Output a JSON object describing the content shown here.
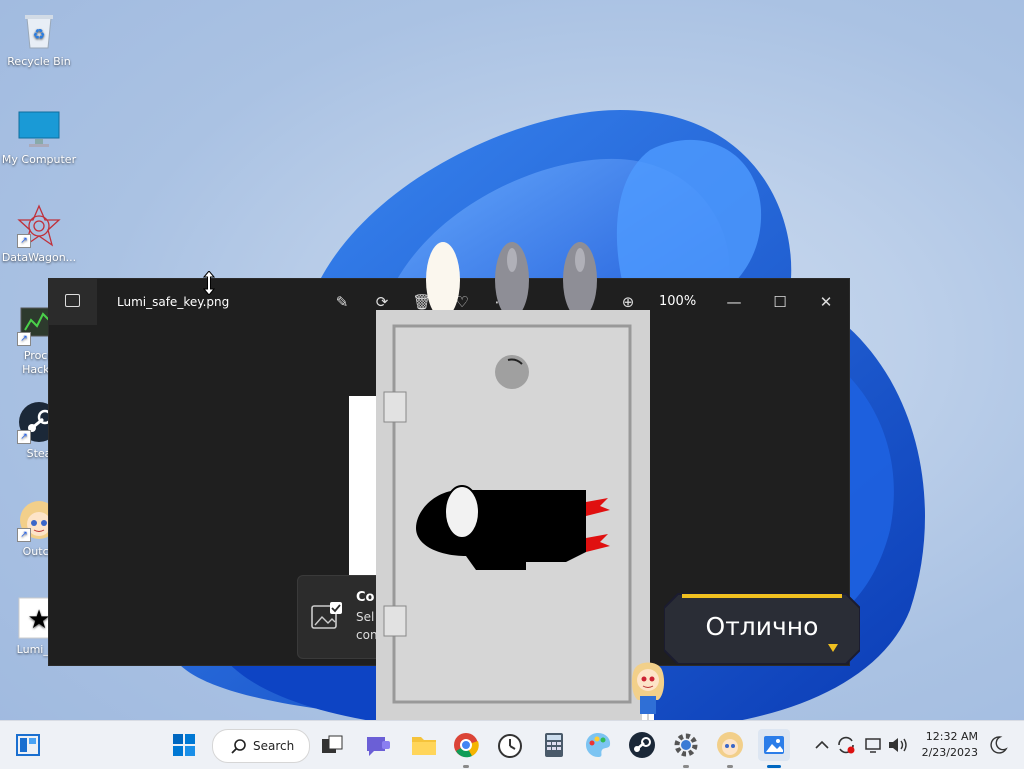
{
  "desktop": {
    "icons": [
      {
        "label": "Recycle Bin",
        "icon": "recycle-bin-icon"
      },
      {
        "label": "My Computer",
        "icon": "monitor-icon"
      },
      {
        "label": "DataWagon...",
        "icon": "datawagon-icon"
      },
      {
        "label": "Proce",
        "label2": "Hacke",
        "icon": "process-hacker-icon"
      },
      {
        "label": "Stea",
        "icon": "steam-icon"
      },
      {
        "label": "Outco",
        "icon": "outcore-icon"
      },
      {
        "label": "Lumi_sa",
        "icon": "star-file-icon"
      }
    ]
  },
  "photos_window": {
    "file_name": "Lumi_safe_key.png",
    "zoom": "100%",
    "toolbar_icons": [
      "edit-icon",
      "rotate-icon",
      "delete-icon",
      "favorite-icon",
      "more-icon",
      "zoom-icon"
    ],
    "controls": {
      "minimize": "—",
      "maximize": "☐",
      "close": "✕"
    },
    "toast": {
      "title": "Co",
      "line1": "Sel",
      "line2": "con"
    }
  },
  "overlay": {
    "speech": "Отлично"
  },
  "taskbar": {
    "search_label": "Search",
    "time": "12:32 AM",
    "date": "2/23/2023",
    "colors": {
      "accent": "#0067c0",
      "background": "#eef1f6"
    }
  }
}
